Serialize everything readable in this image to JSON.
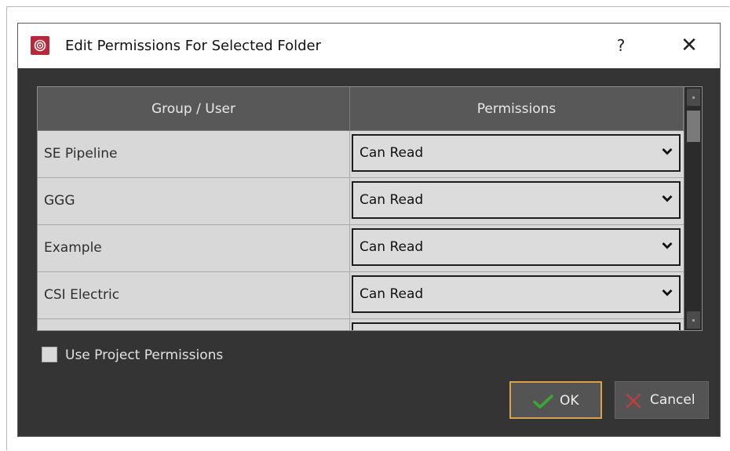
{
  "dialog": {
    "title": "Edit Permissions For Selected Folder",
    "help_label": "?",
    "close_label": "✕",
    "icon": "app-logo-icon",
    "accent_color": "#b8283a"
  },
  "table": {
    "columns": [
      "Group / User",
      "Permissions"
    ],
    "rows": [
      {
        "name": "SE Pipeline",
        "permission": "Can Read"
      },
      {
        "name": "GGG",
        "permission": "Can Read"
      },
      {
        "name": "Example",
        "permission": "Can Read"
      },
      {
        "name": "CSI Electric",
        "permission": "Can Read"
      },
      {
        "name": "",
        "permission": ""
      }
    ]
  },
  "options": {
    "use_project_permissions_label": "Use Project Permissions",
    "use_project_permissions_checked": false
  },
  "buttons": {
    "ok_label": "OK",
    "cancel_label": "Cancel",
    "ok_icon": "checkmark-icon",
    "cancel_icon": "x-icon",
    "ok_icon_color": "#3aa637",
    "cancel_icon_color": "#c33c3c",
    "ok_border_color": "#d9a343"
  }
}
